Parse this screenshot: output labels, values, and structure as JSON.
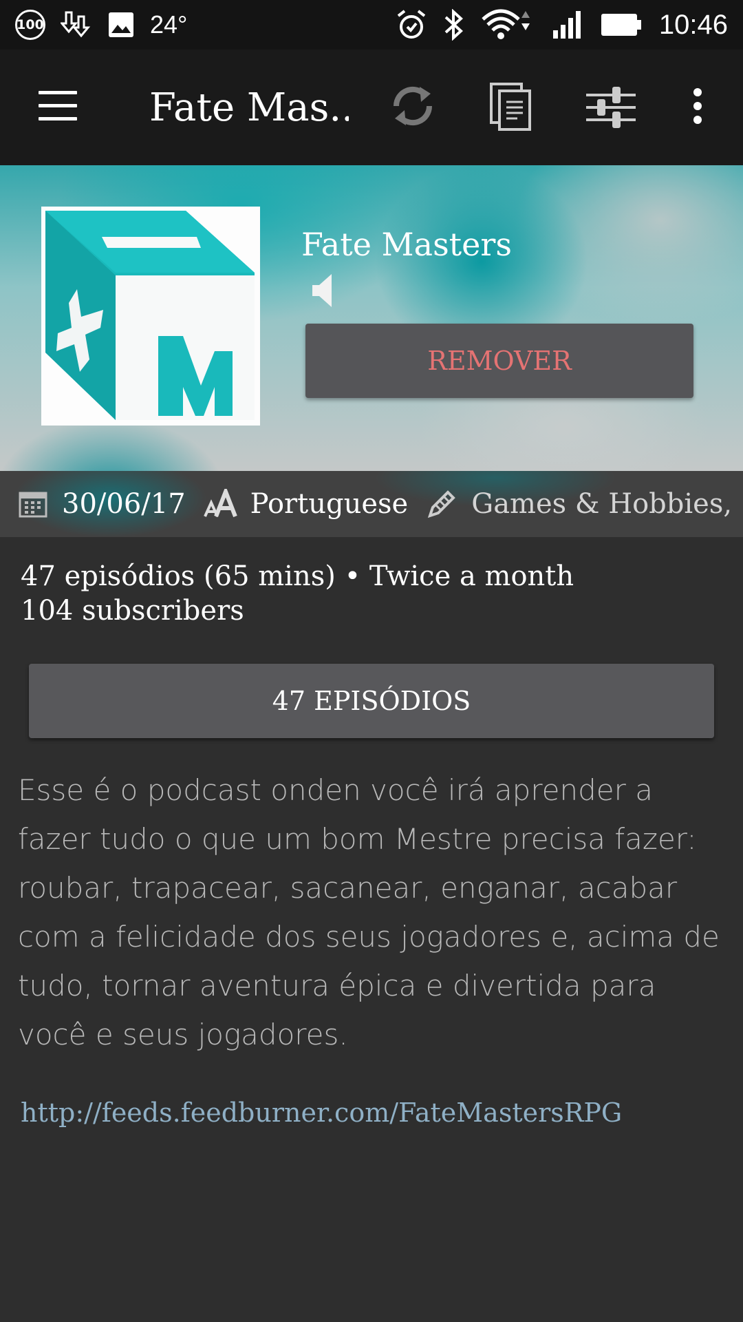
{
  "status_bar": {
    "battery_circle": "100",
    "temperature": "24°",
    "time": "10:46",
    "icons": [
      "battery-circle-icon",
      "download-icon",
      "image-icon",
      "alarm-icon",
      "bluetooth-icon",
      "wifi-icon",
      "signal-icon",
      "battery-icon"
    ]
  },
  "toolbar": {
    "title": "Fate Mas...",
    "icons": [
      "menu-icon",
      "refresh-icon",
      "copy-icon",
      "filter-sliders-icon",
      "more-vertical-icon"
    ]
  },
  "header": {
    "podcast_name": "Fate Masters",
    "remove_label": "REMOVER",
    "remove_color": "#e57373"
  },
  "meta": {
    "date": "30/06/17",
    "language": "Portuguese",
    "categories": "Games & Hobbies, ..."
  },
  "stats": {
    "line1": "47 episódios (65 mins) • Twice a month",
    "line2": "104 subscribers"
  },
  "episodes_button": "47 EPISÓDIOS",
  "description": "Esse é o podcast onden você irá aprender a fazer tudo o que um bom Mestre precisa fazer: roubar, trapacear, sacanear, enganar, acabar com a felicidade dos seus jogadores e, acima de tudo, tornar aventura épica e divertida para você e seus jogadores.",
  "feed_url": "http://feeds.feedburner.com/FateMastersRPG",
  "colors": {
    "background": "#2e2e2e",
    "toolbar": "#1a1a1a",
    "accent_teal": "#1fb8b8",
    "link": "#8fb0c6"
  }
}
